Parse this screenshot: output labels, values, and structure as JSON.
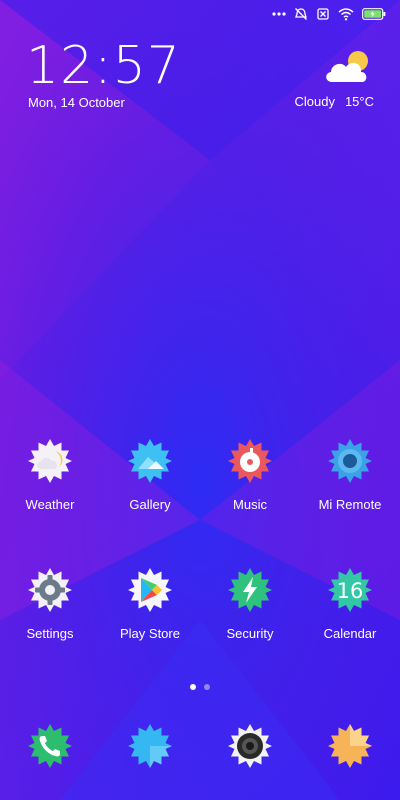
{
  "status_bar": {
    "icons": [
      "more-dots-icon",
      "alarm-off-icon",
      "no-sim-icon",
      "wifi-icon",
      "battery-charging-icon"
    ],
    "battery_color": "#7be26b"
  },
  "lockscreen_widget": {
    "time": "12:57",
    "date": "Mon, 14 October",
    "weather_condition": "Cloudy",
    "temperature": "15°C",
    "weather_icon": "cloud-sun-icon"
  },
  "home_apps": [
    {
      "label": "Weather",
      "icon": "weather-icon",
      "color": "#f4f2f7",
      "accent": "#f7c65a"
    },
    {
      "label": "Gallery",
      "icon": "gallery-icon",
      "color": "#3fc0f3",
      "accent": "#8fe0ff"
    },
    {
      "label": "Music",
      "icon": "music-icon",
      "color": "#e9585e",
      "accent": "#ffffff"
    },
    {
      "label": "Mi Remote",
      "icon": "remote-icon",
      "color": "#3aa3e6",
      "accent": "#1c5b9a"
    },
    {
      "label": "Settings",
      "icon": "settings-gear-icon",
      "color": "#f2f2f6",
      "accent": "#6d7a8c"
    },
    {
      "label": "Play Store",
      "icon": "play-store-icon",
      "color": "#f6f6fb",
      "accent": "#ef4a4a"
    },
    {
      "label": "Security",
      "icon": "security-bolt-icon",
      "color": "#2ec27e",
      "accent": "#ffffff"
    },
    {
      "label": "Calendar",
      "icon": "calendar-icon",
      "color": "#32c7a5",
      "accent": "#ffffff",
      "day": "16"
    }
  ],
  "page_indicator": {
    "pages": 2,
    "current": 1
  },
  "dock_apps": [
    {
      "icon": "phone-icon",
      "color": "#2dbd6e",
      "accent": "#ffffff"
    },
    {
      "icon": "messages-icon",
      "color": "#35b8f2",
      "accent": "#8fdcff"
    },
    {
      "icon": "camera-icon",
      "color": "#f2f2f2",
      "accent": "#2a2a2a"
    },
    {
      "icon": "browser-icon",
      "color": "#f7b357",
      "accent": "#fcd38a"
    }
  ]
}
